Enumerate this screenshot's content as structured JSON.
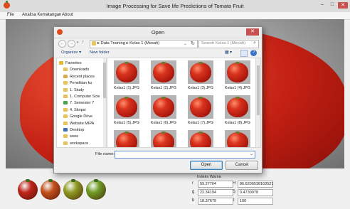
{
  "app": {
    "title": "Image Processing for Save life Predictions of Tomato Fruit",
    "controls": {
      "minimize": "–",
      "maximize": "□",
      "close": "✕"
    }
  },
  "menu": [
    "File",
    "Analisa Kematangan",
    "About"
  ],
  "dialog": {
    "title": "Open",
    "close": "✕",
    "address": {
      "path": "▸ Data Training ▸ Kelas 1 (Mesah)",
      "dropdown": "⌄",
      "refresh": "↻"
    },
    "search": {
      "placeholder": "Search Kelas 1 (Mesah)",
      "icon": "⌕"
    },
    "toolbar": {
      "organize": "Organize ▾",
      "new_folder": "New folder",
      "view": "▦ ▾",
      "help": "?"
    },
    "tree": [
      {
        "label": "Favorites",
        "icon": "star-icon",
        "color": "#e7b62a"
      },
      {
        "label": "Downloads",
        "icon": "folder-icon",
        "color": "#e9c25a"
      },
      {
        "label": "Recent places",
        "icon": "recent-icon",
        "color": "#d9a94a"
      },
      {
        "label": "Penelitian ku",
        "icon": "folder-icon",
        "color": "#e9c25a"
      },
      {
        "label": "1. Study",
        "icon": "folder-icon",
        "color": "#e9c25a"
      },
      {
        "label": "1. Computer Scie",
        "icon": "folder-icon",
        "color": "#e9c25a"
      },
      {
        "label": "7. Semester 7",
        "icon": "folder-icon",
        "color": "#4aa34a"
      },
      {
        "label": "4. Skripsi",
        "icon": "folder-icon",
        "color": "#e9c25a"
      },
      {
        "label": "Google Drive",
        "icon": "drive-icon",
        "color": "#e9c25a"
      },
      {
        "label": "Website MIPA",
        "icon": "folder-icon",
        "color": "#e9c25a"
      },
      {
        "label": "Desktop",
        "icon": "desktop-icon",
        "color": "#3a6fb6"
      },
      {
        "label": "www",
        "icon": "folder-icon",
        "color": "#e9c25a"
      },
      {
        "label": "workspace",
        "icon": "folder-icon",
        "color": "#e9c25a"
      }
    ],
    "files": [
      "Kelas1 (1).JPG",
      "Kelas1 (2).JPG",
      "Kelas1 (3).JPG",
      "Kelas1 (4).JPG",
      "Kelas1 (5).JPG",
      "Kelas1 (6).JPG",
      "Kelas1 (7).JPG",
      "Kelas1 (8).JPG",
      "",
      "",
      "",
      ""
    ],
    "filename": {
      "label": "File name:",
      "value": "",
      "dropdown": "⌄"
    },
    "buttons": {
      "open": "Open",
      "cancel": "Cancel"
    }
  },
  "indeks": {
    "title": "Indeks Warna",
    "fields": [
      {
        "label": "r",
        "value": "59.27764"
      },
      {
        "label": "g",
        "value": "22.34194"
      },
      {
        "label": "b",
        "value": "18.37679"
      },
      {
        "label": "H",
        "value": "86.6206538163521"
      },
      {
        "label": "S",
        "value": "0.4730978"
      },
      {
        "label": "I",
        "value": "100"
      }
    ]
  },
  "sample_colors": [
    "#c0261a",
    "#c4501c",
    "#8f9a22",
    "#6f9b24"
  ]
}
